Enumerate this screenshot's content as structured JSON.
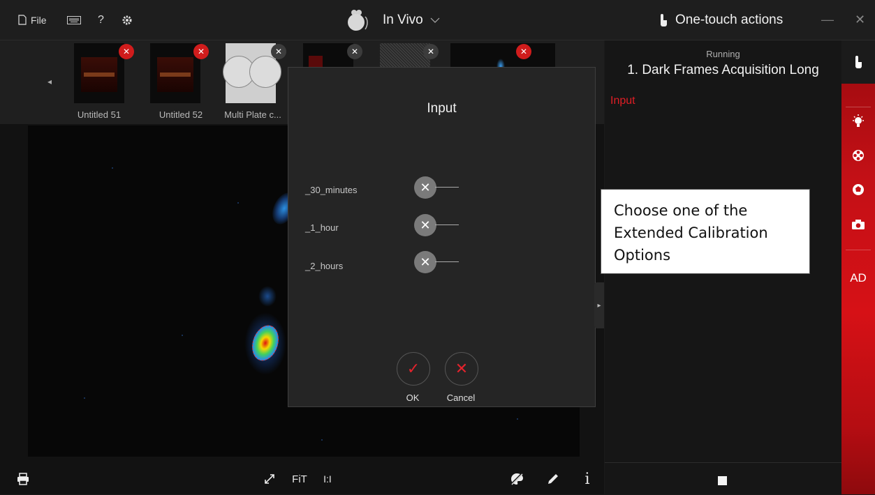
{
  "titlebar": {
    "file_label": "File",
    "help_label": "?",
    "mode": "In Vivo",
    "actions_title": "One-touch actions",
    "minimize": "—",
    "close": "✕"
  },
  "thumbnails": [
    {
      "label": "Untitled 51",
      "x_style": "red"
    },
    {
      "label": "Untitled 52",
      "x_style": "red"
    },
    {
      "label": "Multi Plate c...",
      "x_style": "dark"
    },
    {
      "label": "",
      "x_style": "dark"
    },
    {
      "label": "",
      "x_style": "dark"
    },
    {
      "label": "",
      "x_style": "red"
    }
  ],
  "dialog": {
    "title": "Input",
    "options": [
      {
        "label": "_30_minutes",
        "checked": false
      },
      {
        "label": "_1_hour",
        "checked": false
      },
      {
        "label": "_2_hours",
        "checked": false
      }
    ],
    "ok_label": "OK",
    "cancel_label": "Cancel"
  },
  "panel": {
    "status": "Running",
    "action_name": "1. Dark Frames Acquisition Long",
    "section_label": "Input"
  },
  "sidebar": {
    "ad_label": "AD"
  },
  "toolbar": {
    "fit_label": "FiT",
    "one_to_one_label": "I:I",
    "info_label": "i"
  },
  "tooltip": {
    "text": "Choose one of the Extended Calibration Options"
  },
  "colors": {
    "accent_red": "#d61116",
    "dialog_bg": "#252525",
    "panel_bg": "#161616"
  },
  "icons": [
    "file-icon",
    "keyboard-icon",
    "gear-icon",
    "mouse-logo-icon",
    "chevron-down-icon",
    "touch-icon",
    "printer-icon",
    "expand-icon",
    "palette-off-icon",
    "pencil-icon",
    "info-icon",
    "lightbulb-icon",
    "filter-wheel-icon",
    "aperture-icon",
    "camera-icon",
    "stop-icon",
    "check-icon",
    "cancel-icon",
    "close-icon"
  ]
}
